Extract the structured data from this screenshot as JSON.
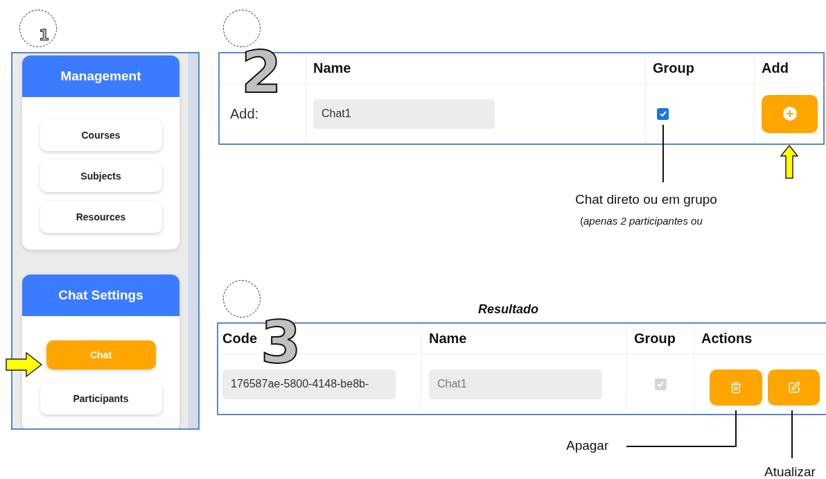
{
  "step_numbers": [
    "1",
    "2",
    "3"
  ],
  "sidebar": {
    "sections": [
      {
        "title": "Management",
        "items": [
          {
            "label": "Courses",
            "selected": false
          },
          {
            "label": "Subjects",
            "selected": false
          },
          {
            "label": "Resources",
            "selected": false
          }
        ]
      },
      {
        "title": "Chat Settings",
        "items": [
          {
            "label": "Chat",
            "selected": true
          },
          {
            "label": "Participants",
            "selected": false
          }
        ]
      }
    ]
  },
  "add_form": {
    "columns": [
      "Name",
      "Group",
      "Add"
    ],
    "row_label": "Add:",
    "name_value": "Chat1",
    "group_checked": true
  },
  "annotations": {
    "group_note": "Chat direto ou em grupo",
    "group_note_detail": "(*apenas 2 participantes ou*",
    "result_title": "Resultado",
    "delete_note": "Apagar",
    "update_note": "Atualizar"
  },
  "results": {
    "columns": [
      "Code",
      "Name",
      "Group",
      "Actions"
    ],
    "rows": [
      {
        "code": "176587ae-5800-4148-be8b-",
        "name": "Chat1",
        "group_checked": true,
        "group_disabled": true
      }
    ]
  }
}
